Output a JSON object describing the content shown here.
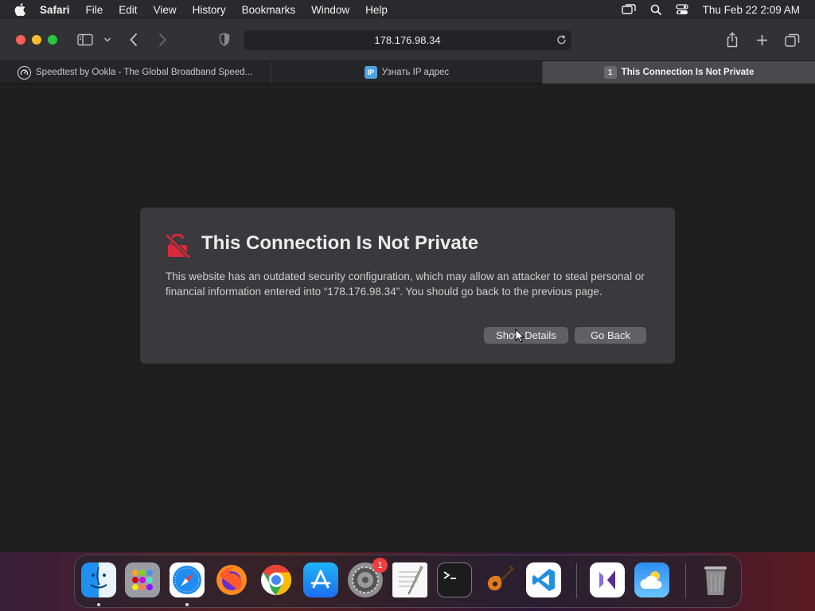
{
  "menubar": {
    "app_name": "Safari",
    "items": [
      "File",
      "Edit",
      "View",
      "History",
      "Bookmarks",
      "Window",
      "Help"
    ],
    "clock": "Thu Feb 22  2:09 AM"
  },
  "toolbar": {
    "url": "178.176.98.34"
  },
  "tabs": [
    {
      "title": "Speedtest by Ookla - The Global Broadband Speed...",
      "favicon": "ookla-icon"
    },
    {
      "title": "Узнать IP адрес",
      "favicon": "ip-icon",
      "favicon_text": "IP"
    },
    {
      "title": "This Connection Is Not Private",
      "favicon": "number-icon",
      "favicon_text": "1",
      "active": true
    }
  ],
  "warning": {
    "title": "This Connection Is Not Private",
    "message": "This website has an outdated security configuration, which may allow an attacker to steal personal or financial information entered into “178.176.98.34”. You should go back to the previous page.",
    "show_details_label": "Show Details",
    "go_back_label": "Go Back",
    "accent_color": "#e0303f"
  },
  "dock": {
    "apps": [
      "finder",
      "launchpad",
      "safari",
      "firefox",
      "chrome",
      "app-store",
      "system-settings",
      "textedit",
      "terminal",
      "garageband",
      "vscode",
      "visual-studio",
      "weather",
      "trash"
    ],
    "system_settings_badge": "1"
  }
}
